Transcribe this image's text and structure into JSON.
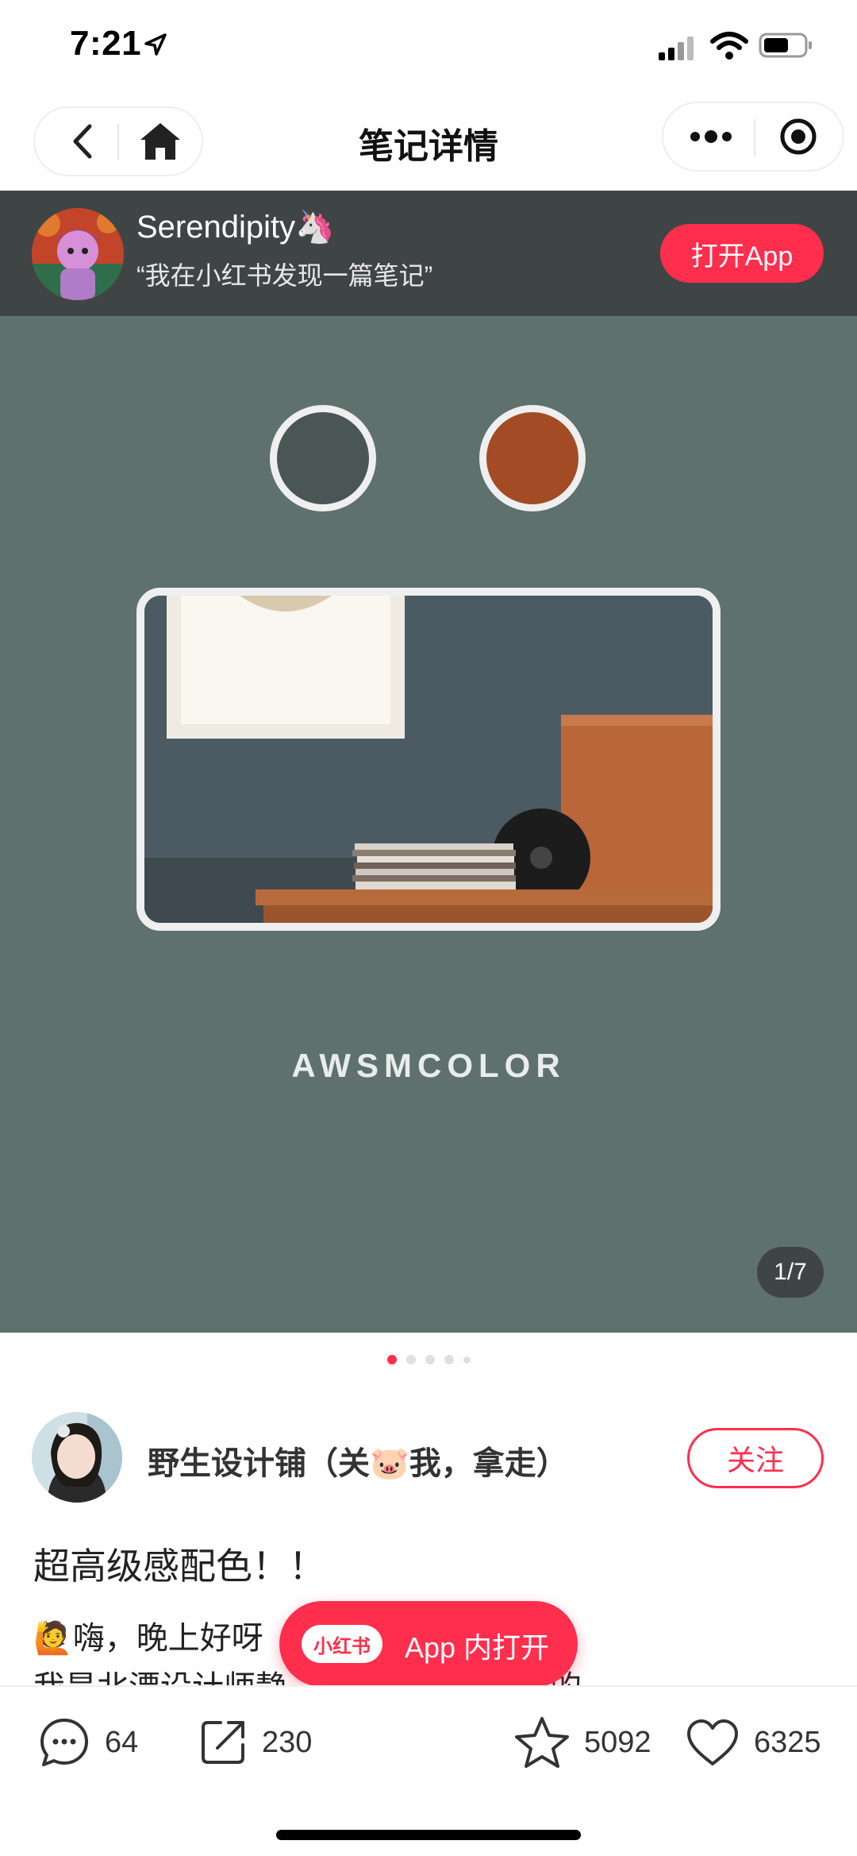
{
  "status_bar": {
    "time": "7:21"
  },
  "nav": {
    "title": "笔记详情"
  },
  "banner": {
    "name": "Serendipity🦄",
    "subtitle": "“我在小红书发现一篇笔记”",
    "open_app_label": "打开App"
  },
  "carousel": {
    "brand_text": "AWSMCOLOR",
    "page_indicator": "1/7",
    "swatch_colors": [
      "#4a5656",
      "#a24b24"
    ],
    "background_color": "#5e716c",
    "dot_count": 5,
    "active_dot": 0
  },
  "author": {
    "name": "野生设计铺（关🐷我，拿走）",
    "follow_label": "关注"
  },
  "post": {
    "title": "超高级感配色！！",
    "line1": "🙋嗨，晚上好呀",
    "line2": "我是北漂设计师静… …设计领域总结的"
  },
  "float_pill": {
    "logo_text": "小红书",
    "label": "App 内打开"
  },
  "actions": {
    "comments": "64",
    "shares": "230",
    "stars": "5092",
    "likes": "6325"
  },
  "colors": {
    "accent": "#ff2e4d",
    "banner_bg": "#3f4545"
  }
}
